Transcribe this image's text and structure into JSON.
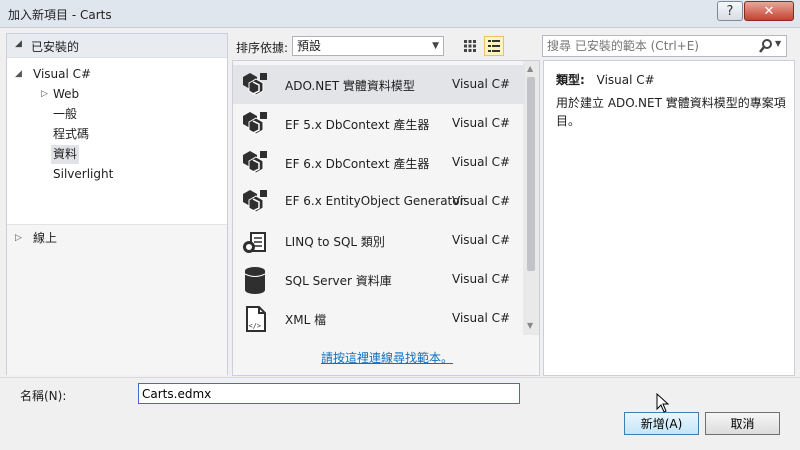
{
  "window": {
    "title": "加入新項目 - Carts",
    "help_label": "?",
    "close_label": "✕"
  },
  "left_pane": {
    "installed_label": "已安裝的",
    "tree": [
      {
        "label": "Visual C#"
      },
      {
        "label": "Web"
      },
      {
        "label": "一般"
      },
      {
        "label": "程式碼"
      },
      {
        "label": "資料",
        "selected": true
      },
      {
        "label": "Silverlight"
      }
    ],
    "online_label": "線上"
  },
  "toolbar": {
    "sort_label": "排序依據:",
    "sort_value": "預設",
    "views": [
      {
        "icon": "small-icons-view-icon",
        "active": false
      },
      {
        "icon": "list-view-icon",
        "active": true
      }
    ]
  },
  "search": {
    "placeholder": "搜尋 已安裝的範本 (Ctrl+E)",
    "icon": "search-icon"
  },
  "templates": [
    {
      "name": "ADO.NET 實體資料模型",
      "lang": "Visual C#",
      "icon": "entity-model-icon",
      "selected": true
    },
    {
      "name": "EF 5.x DbContext 產生器",
      "lang": "Visual C#",
      "icon": "entity-model-icon"
    },
    {
      "name": "EF 6.x DbContext 產生器",
      "lang": "Visual C#",
      "icon": "entity-model-icon"
    },
    {
      "name": "EF 6.x EntityObject Generator",
      "lang": "Visual C#",
      "icon": "entity-model-icon"
    },
    {
      "name": "LINQ to SQL 類別",
      "lang": "Visual C#",
      "icon": "linq-to-sql-icon"
    },
    {
      "name": "SQL Server 資料庫",
      "lang": "Visual C#",
      "icon": "database-icon"
    },
    {
      "name": "XML 檔",
      "lang": "Visual C#",
      "icon": "xml-file-icon"
    }
  ],
  "online_link": "請按這裡連線尋找範本。",
  "details": {
    "type_label": "類型:",
    "type_value": "Visual C#",
    "description": "用於建立 ADO.NET 實體資料模型的專案項目。"
  },
  "bottom": {
    "name_label": "名稱(N):",
    "name_value": "Carts.edmx",
    "add_label": "新增(A)",
    "cancel_label": "取消"
  }
}
